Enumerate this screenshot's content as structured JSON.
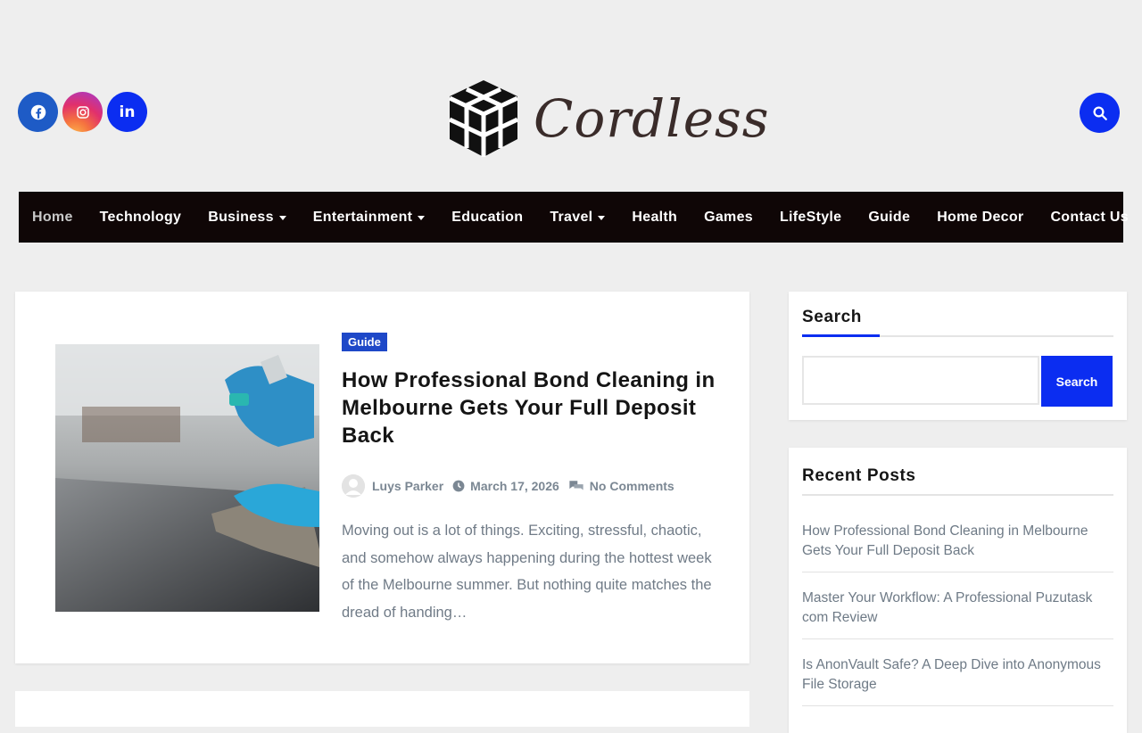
{
  "header": {
    "logo_text": "Cordless",
    "social": [
      {
        "name": "facebook",
        "icon": "facebook-icon"
      },
      {
        "name": "instagram",
        "icon": "instagram-icon"
      },
      {
        "name": "linkedin",
        "icon": "linkedin-icon",
        "label": "in"
      }
    ]
  },
  "nav": {
    "items": [
      {
        "label": "Home",
        "active": true
      },
      {
        "label": "Technology"
      },
      {
        "label": "Business",
        "dropdown": true
      },
      {
        "label": "Entertainment",
        "dropdown": true
      },
      {
        "label": "Education"
      },
      {
        "label": "Travel",
        "dropdown": true
      },
      {
        "label": "Health"
      },
      {
        "label": "Games"
      },
      {
        "label": "LifeStyle"
      },
      {
        "label": "Guide"
      },
      {
        "label": "Home Decor"
      },
      {
        "label": "Contact Us"
      }
    ]
  },
  "post": {
    "category": "Guide",
    "title": "How Professional Bond Cleaning in Melbourne Gets Your Full Deposit Back",
    "author": "Luys Parker",
    "date": "March 17, 2026",
    "comments": "No Comments",
    "excerpt": "Moving out is a lot of things. Exciting, stressful, chaotic, and somehow always happening during the hottest week of the Melbourne summer. But nothing quite matches the dread of handing…"
  },
  "sidebar": {
    "search": {
      "title": "Search",
      "button": "Search",
      "value": ""
    },
    "recent": {
      "title": "Recent Posts",
      "items": [
        "How Professional Bond Cleaning in Melbourne Gets Your Full Deposit Back",
        "Master Your Workflow: A Professional Puzutask com Review",
        "Is AnonVault Safe? A Deep Dive into Anonymous File Storage"
      ]
    }
  },
  "colors": {
    "accent": "#0b2df1",
    "nav_bg": "#0f0606",
    "badge": "#1e48c8"
  }
}
